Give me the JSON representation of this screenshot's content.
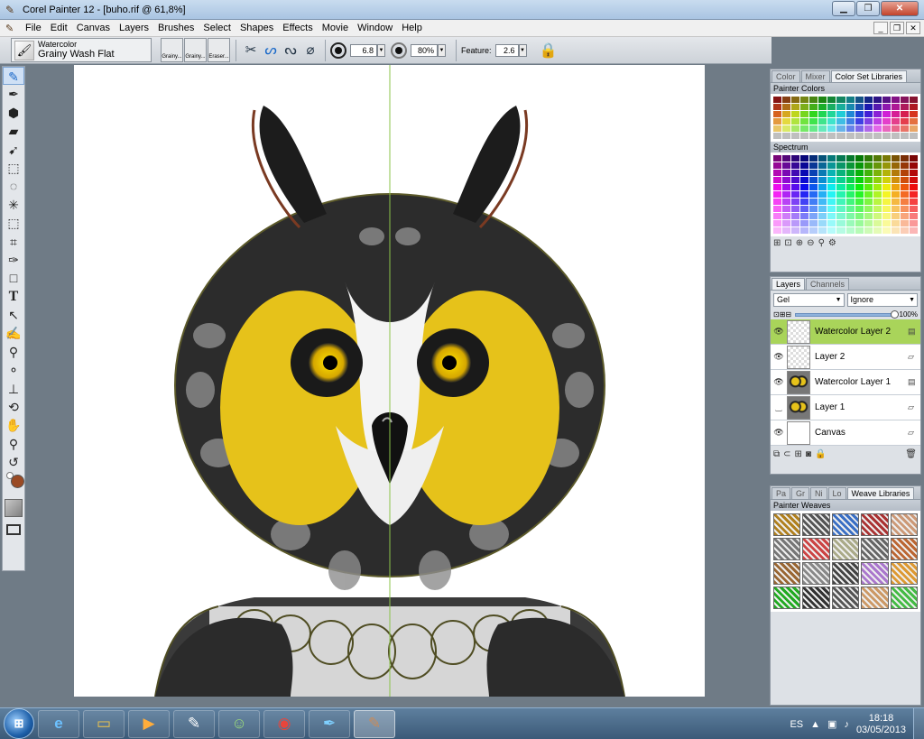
{
  "window": {
    "title": "Corel Painter 12 - [buho.rif @ 61,8%]"
  },
  "menu": [
    "File",
    "Edit",
    "Canvas",
    "Layers",
    "Brushes",
    "Select",
    "Shapes",
    "Effects",
    "Movie",
    "Window",
    "Help"
  ],
  "propbar": {
    "brush_category": "Watercolor",
    "brush_variant": "Grainy Wash Flat",
    "recent_brushes": [
      "Grainy...",
      "Grainy...",
      "Eraser..."
    ],
    "size": "6.8",
    "opacity": "80%",
    "feature_label": "Feature:",
    "feature": "2.6"
  },
  "color_panel": {
    "tabs": [
      "Color",
      "Mixer",
      "Color Set Libraries"
    ],
    "painter_colors_title": "Painter Colors",
    "spectrum_title": "Spectrum"
  },
  "layers_panel": {
    "tabs": [
      "Layers",
      "Channels"
    ],
    "composite_method": "Gel",
    "preserve": "Ignore",
    "opacity": "100%",
    "layers": [
      {
        "name": "Watercolor Layer 2",
        "selected": true,
        "visible": true
      },
      {
        "name": "Layer 2",
        "selected": false,
        "visible": true
      },
      {
        "name": "Watercolor Layer 1",
        "selected": false,
        "visible": true
      },
      {
        "name": "Layer 1",
        "selected": false,
        "visible": false
      },
      {
        "name": "Canvas",
        "selected": false,
        "visible": true
      }
    ]
  },
  "weave_panel": {
    "tabs": [
      "Pa",
      "Gr",
      "Ni",
      "Lo",
      "Weave Libraries"
    ],
    "title": "Painter Weaves"
  },
  "taskbar": {
    "language": "ES",
    "time": "18:18",
    "date": "03/05/2013"
  }
}
